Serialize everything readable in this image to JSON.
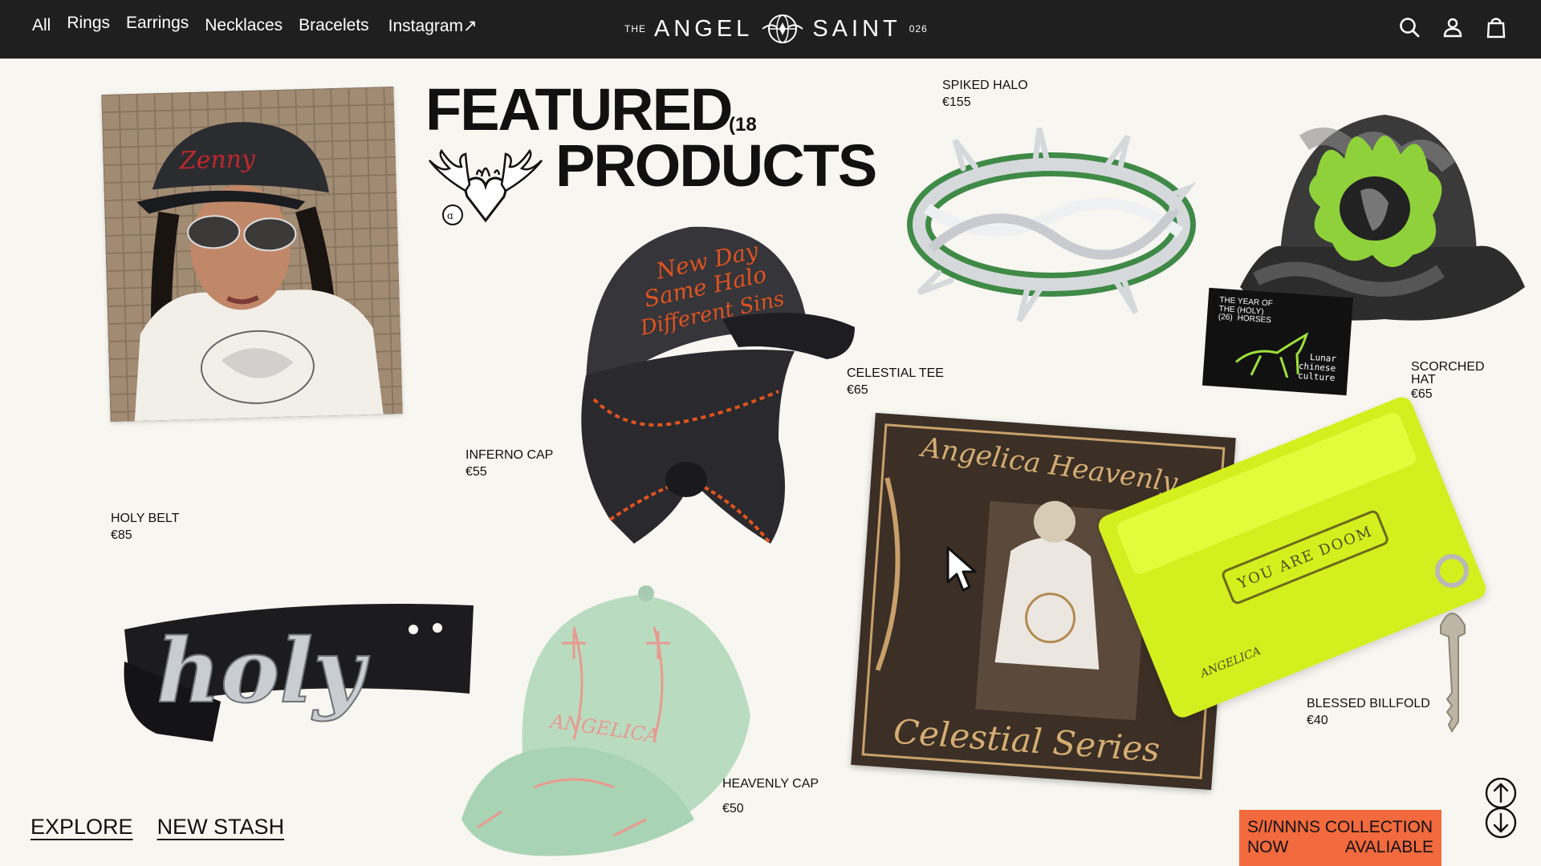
{
  "nav": {
    "links": [
      "All",
      "Rings",
      "Earrings",
      "Necklaces",
      "Bracelets",
      "Instagram↗"
    ],
    "brand_prefix": "THE",
    "brand_left": "ANGEL",
    "brand_right": "SAINT",
    "brand_suffix": "026",
    "icons": [
      "search-icon",
      "account-icon",
      "bag-icon"
    ]
  },
  "headline": {
    "line1": "FEATURED",
    "count": "(18",
    "line2": "PRODUCTS"
  },
  "products": [
    {
      "name": "SPIKED HALO",
      "price": "€155"
    },
    {
      "name": "CELESTIAL TEE",
      "price": "€65"
    },
    {
      "name": "SCORCHED HAT",
      "price": "€65"
    },
    {
      "name": "INFERNO CAP",
      "price": "€55"
    },
    {
      "name": "HOLY BELT",
      "price": "€85"
    },
    {
      "name": "HEAVENLY CAP",
      "price": "€50"
    },
    {
      "name": "BLESSED BILLFOLD",
      "price": "€40"
    }
  ],
  "art_text": {
    "photo_cap": "Zenny",
    "cap_embroidery": [
      "New Day",
      "Same Halo",
      "Different Sins"
    ],
    "horse_card": [
      "THE YEAR OF",
      "THE (HOLY)",
      "(26)",
      "HORSES",
      "Lunar",
      "chinese",
      "culture"
    ],
    "poster_top": "Angelica Heavenly",
    "poster_bottom": "Celestial Series",
    "wallet_banner": "YOU ARE DOOM",
    "wallet_logo": "ANGELICA",
    "belt_word": "holy",
    "green_cap_word": "ANGELICA"
  },
  "bottom_links": [
    "EXPLORE",
    "NEW STASH"
  ],
  "banner": {
    "line1": "S/I/NNNS COLLECTION",
    "line2a": "NOW",
    "line2b": "AVALIABLE"
  },
  "colors": {
    "nav_bg": "#1f1f1f",
    "page_bg": "#f8f6f1",
    "banner": "#f26a3d",
    "wallet": "#d4ef1e",
    "accent_green": "#8fd13a"
  }
}
